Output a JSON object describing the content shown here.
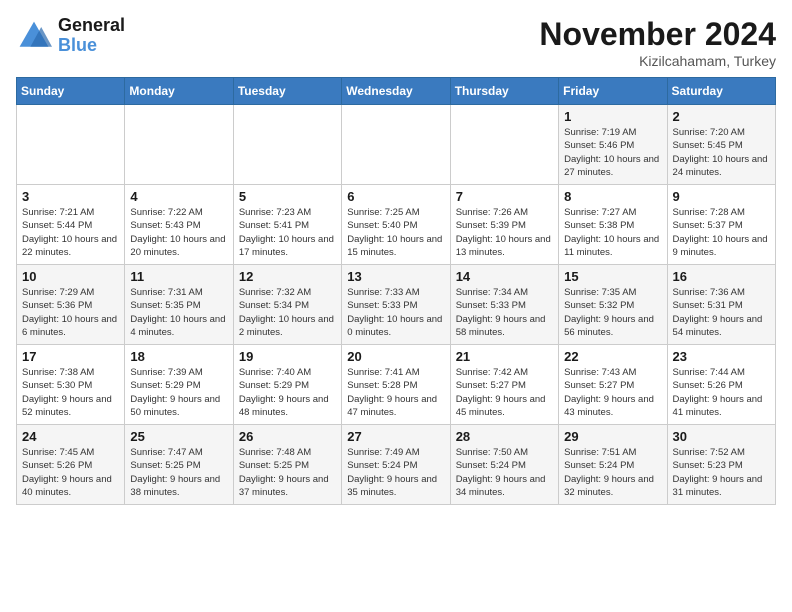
{
  "logo": {
    "text_general": "General",
    "text_blue": "Blue"
  },
  "title": "November 2024",
  "subtitle": "Kizilcahamam, Turkey",
  "days_of_week": [
    "Sunday",
    "Monday",
    "Tuesday",
    "Wednesday",
    "Thursday",
    "Friday",
    "Saturday"
  ],
  "weeks": [
    [
      {
        "day": "",
        "info": ""
      },
      {
        "day": "",
        "info": ""
      },
      {
        "day": "",
        "info": ""
      },
      {
        "day": "",
        "info": ""
      },
      {
        "day": "",
        "info": ""
      },
      {
        "day": "1",
        "info": "Sunrise: 7:19 AM\nSunset: 5:46 PM\nDaylight: 10 hours and 27 minutes."
      },
      {
        "day": "2",
        "info": "Sunrise: 7:20 AM\nSunset: 5:45 PM\nDaylight: 10 hours and 24 minutes."
      }
    ],
    [
      {
        "day": "3",
        "info": "Sunrise: 7:21 AM\nSunset: 5:44 PM\nDaylight: 10 hours and 22 minutes."
      },
      {
        "day": "4",
        "info": "Sunrise: 7:22 AM\nSunset: 5:43 PM\nDaylight: 10 hours and 20 minutes."
      },
      {
        "day": "5",
        "info": "Sunrise: 7:23 AM\nSunset: 5:41 PM\nDaylight: 10 hours and 17 minutes."
      },
      {
        "day": "6",
        "info": "Sunrise: 7:25 AM\nSunset: 5:40 PM\nDaylight: 10 hours and 15 minutes."
      },
      {
        "day": "7",
        "info": "Sunrise: 7:26 AM\nSunset: 5:39 PM\nDaylight: 10 hours and 13 minutes."
      },
      {
        "day": "8",
        "info": "Sunrise: 7:27 AM\nSunset: 5:38 PM\nDaylight: 10 hours and 11 minutes."
      },
      {
        "day": "9",
        "info": "Sunrise: 7:28 AM\nSunset: 5:37 PM\nDaylight: 10 hours and 9 minutes."
      }
    ],
    [
      {
        "day": "10",
        "info": "Sunrise: 7:29 AM\nSunset: 5:36 PM\nDaylight: 10 hours and 6 minutes."
      },
      {
        "day": "11",
        "info": "Sunrise: 7:31 AM\nSunset: 5:35 PM\nDaylight: 10 hours and 4 minutes."
      },
      {
        "day": "12",
        "info": "Sunrise: 7:32 AM\nSunset: 5:34 PM\nDaylight: 10 hours and 2 minutes."
      },
      {
        "day": "13",
        "info": "Sunrise: 7:33 AM\nSunset: 5:33 PM\nDaylight: 10 hours and 0 minutes."
      },
      {
        "day": "14",
        "info": "Sunrise: 7:34 AM\nSunset: 5:33 PM\nDaylight: 9 hours and 58 minutes."
      },
      {
        "day": "15",
        "info": "Sunrise: 7:35 AM\nSunset: 5:32 PM\nDaylight: 9 hours and 56 minutes."
      },
      {
        "day": "16",
        "info": "Sunrise: 7:36 AM\nSunset: 5:31 PM\nDaylight: 9 hours and 54 minutes."
      }
    ],
    [
      {
        "day": "17",
        "info": "Sunrise: 7:38 AM\nSunset: 5:30 PM\nDaylight: 9 hours and 52 minutes."
      },
      {
        "day": "18",
        "info": "Sunrise: 7:39 AM\nSunset: 5:29 PM\nDaylight: 9 hours and 50 minutes."
      },
      {
        "day": "19",
        "info": "Sunrise: 7:40 AM\nSunset: 5:29 PM\nDaylight: 9 hours and 48 minutes."
      },
      {
        "day": "20",
        "info": "Sunrise: 7:41 AM\nSunset: 5:28 PM\nDaylight: 9 hours and 47 minutes."
      },
      {
        "day": "21",
        "info": "Sunrise: 7:42 AM\nSunset: 5:27 PM\nDaylight: 9 hours and 45 minutes."
      },
      {
        "day": "22",
        "info": "Sunrise: 7:43 AM\nSunset: 5:27 PM\nDaylight: 9 hours and 43 minutes."
      },
      {
        "day": "23",
        "info": "Sunrise: 7:44 AM\nSunset: 5:26 PM\nDaylight: 9 hours and 41 minutes."
      }
    ],
    [
      {
        "day": "24",
        "info": "Sunrise: 7:45 AM\nSunset: 5:26 PM\nDaylight: 9 hours and 40 minutes."
      },
      {
        "day": "25",
        "info": "Sunrise: 7:47 AM\nSunset: 5:25 PM\nDaylight: 9 hours and 38 minutes."
      },
      {
        "day": "26",
        "info": "Sunrise: 7:48 AM\nSunset: 5:25 PM\nDaylight: 9 hours and 37 minutes."
      },
      {
        "day": "27",
        "info": "Sunrise: 7:49 AM\nSunset: 5:24 PM\nDaylight: 9 hours and 35 minutes."
      },
      {
        "day": "28",
        "info": "Sunrise: 7:50 AM\nSunset: 5:24 PM\nDaylight: 9 hours and 34 minutes."
      },
      {
        "day": "29",
        "info": "Sunrise: 7:51 AM\nSunset: 5:24 PM\nDaylight: 9 hours and 32 minutes."
      },
      {
        "day": "30",
        "info": "Sunrise: 7:52 AM\nSunset: 5:23 PM\nDaylight: 9 hours and 31 minutes."
      }
    ]
  ]
}
